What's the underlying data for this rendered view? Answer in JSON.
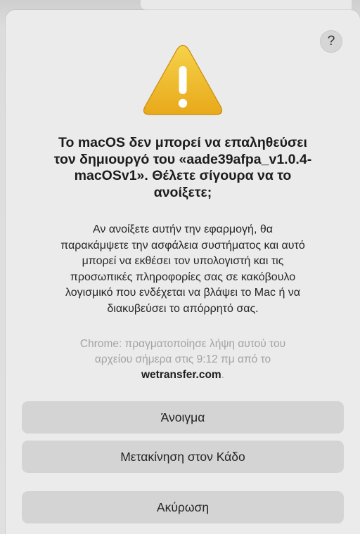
{
  "dialog": {
    "help_label": "?",
    "icon": "warning-triangle-icon",
    "title": "Το macOS δεν μπορεί να επαληθεύσει\nτον δημιουργό του «aade39afpa_v1.0.4-\nmacOSv1». Θέλετε σίγουρα να το\nανοίξετε;",
    "message": "Αν ανοίξετε αυτήν την εφαρμογή, θα\nπαρακάμψετε την ασφάλεια συστήματος και αυτό\nμπορεί να εκθέσει τον υπολογιστή και τις\nπροσωπικές πληροφορίες σας σε κακόβουλο\nλογισμικό που ενδέχεται να βλάψει το Mac ή να\nδιακυβεύσει το απόρρητό σας.",
    "source": {
      "text": "Chrome: πραγματοποίησε λήψη αυτού του\nαρχείου σήμερα στις 9:12 πμ από το\n",
      "domain": "wetransfer.com",
      "suffix": "."
    },
    "buttons": {
      "open": "Άνοιγμα",
      "move_to_trash": "Μετακίνηση στον Κάδο",
      "cancel": "Ακύρωση"
    },
    "colors": {
      "warning_yellow": "#f2c12e",
      "warning_dark": "#d99a10",
      "button_bg": "#d4d4d4",
      "dialog_bg": "#ebebeb"
    }
  }
}
